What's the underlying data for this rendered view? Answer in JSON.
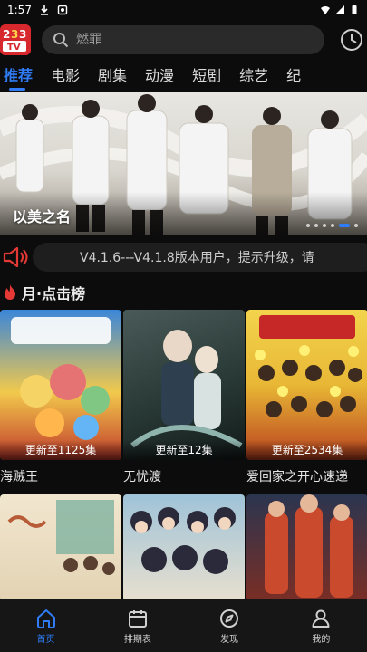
{
  "status_bar": {
    "time": "1:57"
  },
  "search": {
    "placeholder": "燃罪"
  },
  "tabs": [
    "推荐",
    "电影",
    "剧集",
    "动漫",
    "短剧",
    "综艺",
    "纪"
  ],
  "banner": {
    "title": "以美之名",
    "dot_count": 6,
    "active_dot": 4
  },
  "notice": {
    "text": "V4.1.6---V4.1.8版本用户，提示升级，请"
  },
  "section": {
    "title": "月·点击榜"
  },
  "items": [
    {
      "title": "海贼王",
      "badge": "更新至1125集"
    },
    {
      "title": "无忧渡",
      "badge": "更新至12集"
    },
    {
      "title": "爱回家之开心速递",
      "badge": "更新至2534集"
    }
  ],
  "bottom_nav": [
    {
      "label": "首页",
      "icon": "home-icon"
    },
    {
      "label": "排期表",
      "icon": "calendar-icon"
    },
    {
      "label": "发现",
      "icon": "compass-icon"
    },
    {
      "label": "我的",
      "icon": "user-icon"
    }
  ],
  "colors": {
    "accent": "#2f7cf6",
    "background": "#0c0c0c",
    "alert": "#e53935",
    "logo": "#d7282e"
  }
}
